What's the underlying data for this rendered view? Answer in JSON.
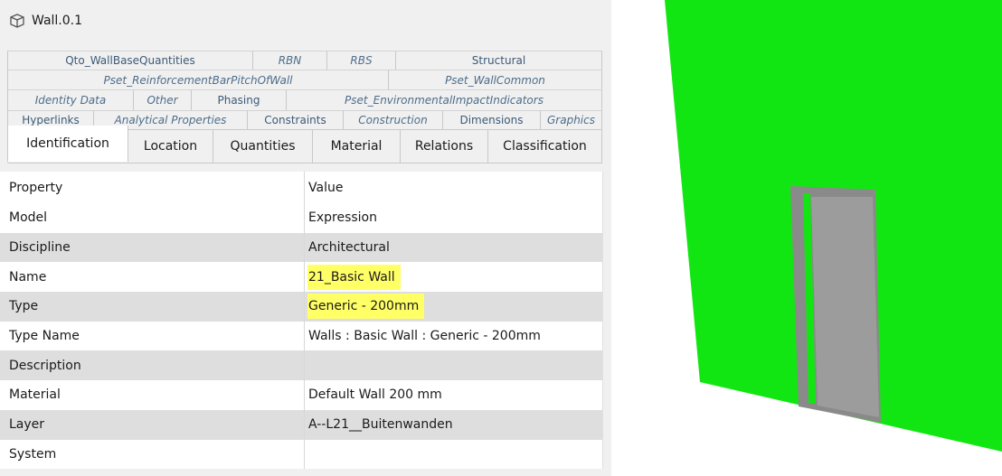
{
  "window": {
    "title": "Wall.0.1",
    "icon": "cube-outline-icon"
  },
  "tabs": {
    "row1": [
      "Qto_WallBaseQuantities",
      "RBN",
      "RBS",
      "Structural"
    ],
    "row2": [
      "Pset_ReinforcementBarPitchOfWall",
      "Pset_WallCommon"
    ],
    "row3": [
      "Identity Data",
      "Other",
      "Phasing",
      "Pset_EnvironmentalImpactIndicators"
    ],
    "row4": [
      "Hyperlinks",
      "Analytical Properties",
      "Constraints",
      "Construction",
      "Dimensions",
      "Graphics"
    ],
    "row5": [
      "Identification",
      "Location",
      "Quantities",
      "Material",
      "Relations",
      "Classification"
    ],
    "active": "Identification"
  },
  "grid": {
    "header": {
      "property": "Property",
      "value": "Value"
    },
    "rows": [
      {
        "property": "Model",
        "value": "Expression"
      },
      {
        "property": "Discipline",
        "value": "Architectural"
      },
      {
        "property": "Name",
        "value": "21_Basic Wall",
        "highlighted": true
      },
      {
        "property": "Type",
        "value": "Generic - 200mm",
        "highlighted": true
      },
      {
        "property": "Type Name",
        "value": "Walls : Basic Wall : Generic - 200mm"
      },
      {
        "property": "Description",
        "value": ""
      },
      {
        "property": "Material",
        "value": "Default Wall 200 mm"
      },
      {
        "property": "Layer",
        "value": "A--L21__Buitenwanden"
      },
      {
        "property": "System",
        "value": ""
      }
    ]
  },
  "colors": {
    "wall": "#12e612",
    "door_frame": "#8a8a8a",
    "door_panel": "#9c9c9c",
    "highlight": "#ffff66",
    "tab_text": "#4d6d8a"
  }
}
